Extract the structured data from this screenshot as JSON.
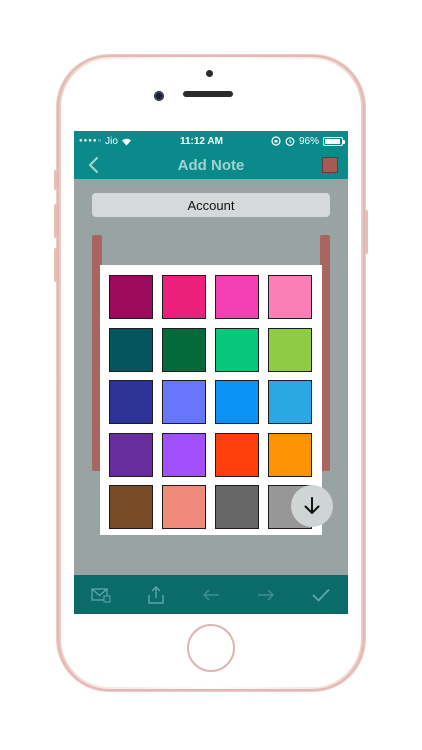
{
  "status_bar": {
    "carrier": "Jio",
    "time": "11:12 AM",
    "battery": "96%",
    "battery_level": 0.96
  },
  "nav": {
    "title": "Add Note",
    "back_icon": "chevron-left-icon",
    "color_icon": "selected-color-swatch",
    "selected_color": "#a65a54"
  },
  "content": {
    "account_label": "Account"
  },
  "color_picker": {
    "colors": [
      "#9c0a5e",
      "#ec1f7c",
      "#f53fb2",
      "#fb7fb7",
      "#06555e",
      "#056a3a",
      "#06c77c",
      "#8fcb45",
      "#2d3396",
      "#6876fe",
      "#0a93f4",
      "#2aa8e4",
      "#672d9a",
      "#a24ffe",
      "#fe3e0b",
      "#fe9304",
      "#784a25",
      "#f08a7a",
      "#676767",
      "#979797"
    ]
  },
  "toolbar": {
    "icons": [
      "mail-icon",
      "share-icon",
      "undo-arrow-icon",
      "redo-arrow-icon",
      "checkmark-icon"
    ]
  },
  "theme": {
    "primary": "#0a8a8a",
    "toolbar": "#0b6a6a"
  }
}
